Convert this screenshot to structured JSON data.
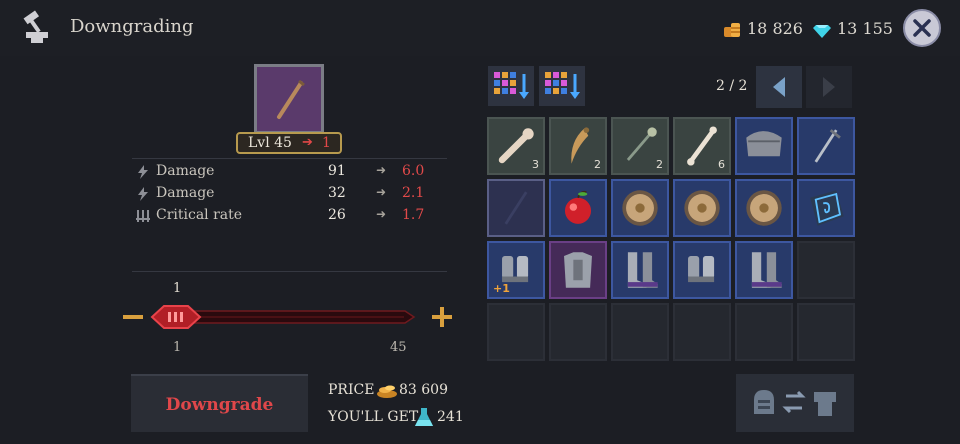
{
  "header": {
    "title": "Downgrading",
    "gold": "18 826",
    "gems": "13 155",
    "icons": {
      "tool": "anvil-hammer-icon",
      "gold": "gold-coins-icon",
      "gem": "diamond-icon",
      "close": "close-icon"
    }
  },
  "item": {
    "level_label": "Lvl 45",
    "new_level": "1",
    "icon": "rusty-sword-icon"
  },
  "stats": [
    {
      "name": "Damage",
      "current": "91",
      "new": "6.0",
      "icon": "lightning-icon"
    },
    {
      "name": "Damage",
      "current": "32",
      "new": "2.1",
      "icon": "lightning-icon"
    },
    {
      "name": "Critical rate",
      "current": "26",
      "new": "1.7",
      "icon": "triple-blade-icon"
    }
  ],
  "slider": {
    "value": "1",
    "min": "1",
    "max": "45",
    "fill_fraction": 0.0
  },
  "actions": {
    "downgrade_label": "Downgrade",
    "price_label": "PRICE",
    "price_value": "83 609",
    "get_label": "YOU'LL GET",
    "get_value": "241"
  },
  "inventory": {
    "page": "2 / 2",
    "cells": [
      {
        "icon": "bone-club-icon",
        "count": "3",
        "rarity": "common"
      },
      {
        "icon": "fang-icon",
        "count": "2",
        "rarity": "common"
      },
      {
        "icon": "mace-icon",
        "count": "2",
        "rarity": "common"
      },
      {
        "icon": "bone-icon",
        "count": "6",
        "rarity": "common"
      },
      {
        "icon": "shoulder-armor-icon",
        "count": "",
        "rarity": "rare"
      },
      {
        "icon": "sword-icon",
        "count": "",
        "rarity": "rare"
      },
      {
        "icon": "empty-selected-slot",
        "count": "",
        "rarity": "selected"
      },
      {
        "icon": "apple-icon",
        "count": "",
        "rarity": "rare"
      },
      {
        "icon": "round-shield-icon",
        "count": "",
        "rarity": "rare"
      },
      {
        "icon": "round-shield-icon",
        "count": "",
        "rarity": "rare"
      },
      {
        "icon": "round-shield-icon",
        "count": "",
        "rarity": "rare"
      },
      {
        "icon": "rune-stone-icon",
        "count": "",
        "rarity": "rare"
      },
      {
        "icon": "gauntlets-icon",
        "count": "",
        "plus": "+1",
        "rarity": "rare"
      },
      {
        "icon": "chest-armor-icon",
        "count": "",
        "rarity": "epic"
      },
      {
        "icon": "boots-icon",
        "count": "",
        "rarity": "rare"
      },
      {
        "icon": "gauntlets-icon",
        "count": "",
        "rarity": "rare"
      },
      {
        "icon": "boots-icon",
        "count": "",
        "rarity": "rare"
      },
      {
        "icon": "",
        "count": "",
        "rarity": "empty"
      },
      {
        "icon": "",
        "count": "",
        "rarity": "empty"
      },
      {
        "icon": "",
        "count": "",
        "rarity": "empty"
      },
      {
        "icon": "",
        "count": "",
        "rarity": "empty"
      },
      {
        "icon": "",
        "count": "",
        "rarity": "empty"
      },
      {
        "icon": "",
        "count": "",
        "rarity": "empty"
      },
      {
        "icon": "",
        "count": "",
        "rarity": "empty"
      }
    ]
  },
  "colors": {
    "accent_red": "#e24848",
    "rare_blue": "#2e3f73",
    "epic_purple": "#4a2e5e",
    "gold": "#e0a03a"
  }
}
